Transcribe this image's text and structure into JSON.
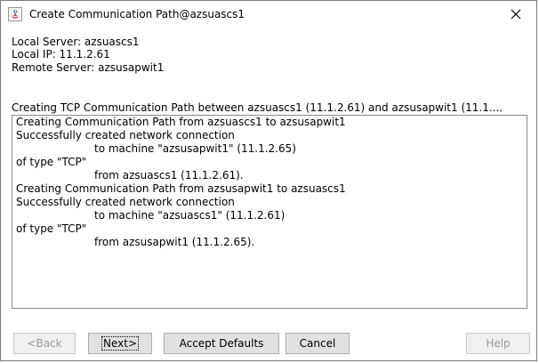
{
  "window": {
    "title": "Create Communication Path@azsuascs1"
  },
  "info": {
    "local_server": "Local Server: azsuascs1",
    "local_ip": "Local IP: 11.1.2.61",
    "remote_server": "Remote Server: azsusapwit1"
  },
  "status_header": "Creating TCP Communication Path between azsuascs1 (11.1.2.61) and azsusapwit1 (11.1....",
  "log": {
    "lines": [
      "Creating Communication Path from azsuascs1 to azsusapwit1",
      "Successfully created network connection",
      "to machine \"azsusapwit1\" (11.1.2.65)",
      "of type \"TCP\"",
      "from azsuascs1 (11.1.2.61).",
      "Creating Communication Path from azsusapwit1 to azsuascs1",
      "Successfully created network connection",
      "to machine \"azsuascs1\" (11.1.2.61)",
      "of type \"TCP\"",
      "from azsusapwit1 (11.1.2.65)."
    ]
  },
  "buttons": {
    "back": "<Back",
    "next": "Next>",
    "accept_defaults": "Accept Defaults",
    "cancel": "Cancel",
    "help": "Help"
  },
  "icons": {
    "app": "java-icon",
    "close": "close-icon"
  }
}
